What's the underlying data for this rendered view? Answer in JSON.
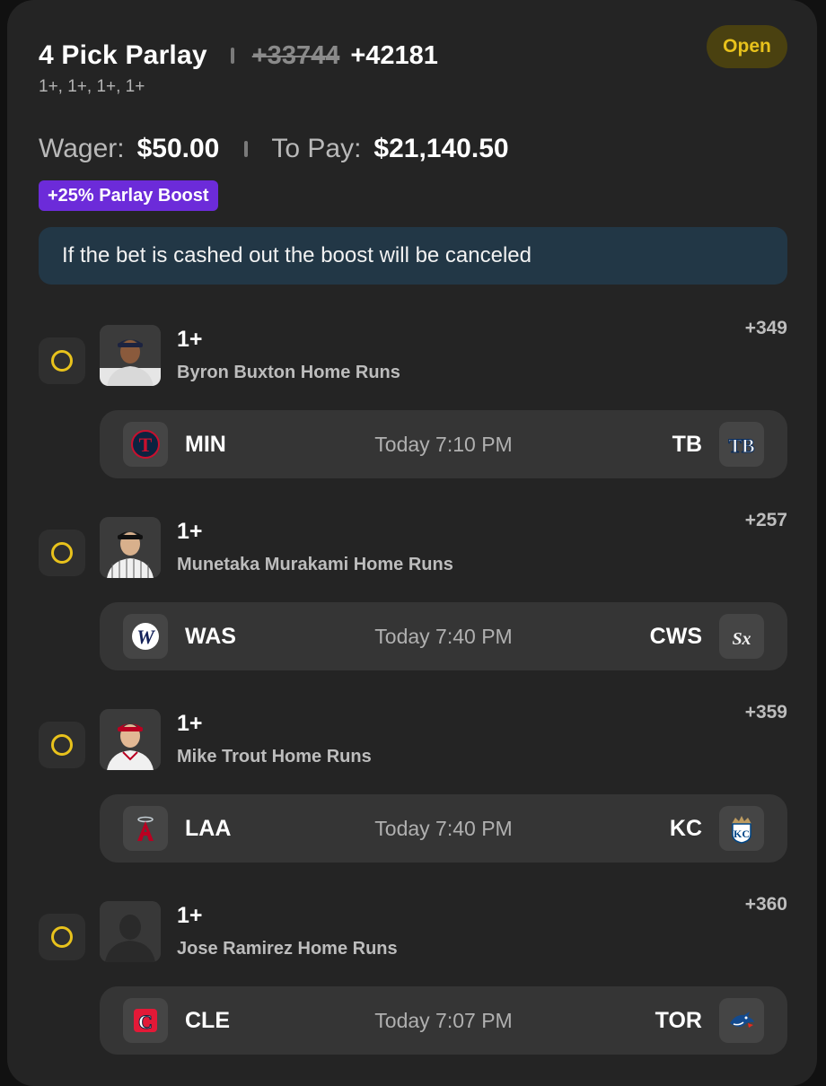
{
  "header": {
    "title": "4 Pick Parlay",
    "original_odds": "+33744",
    "boosted_odds": "+42181",
    "subtitle": "1+, 1+, 1+, 1+",
    "status": "Open"
  },
  "wager": {
    "wager_label": "Wager:",
    "wager_value": "$50.00",
    "pay_label": "To Pay:",
    "pay_value": "$21,140.50"
  },
  "boost_badge": "+25% Parlay Boost",
  "notice": "If the bet is cashed out the boost will be canceled",
  "legs": [
    {
      "line": "1+",
      "player": "Byron Buxton Home Runs",
      "odds": "+349",
      "away": "MIN",
      "time": "Today 7:10 PM",
      "home": "TB",
      "away_icon": "twins-logo-icon",
      "home_icon": "rays-logo-icon"
    },
    {
      "line": "1+",
      "player": "Munetaka Murakami Home Runs",
      "odds": "+257",
      "away": "WAS",
      "time": "Today 7:40 PM",
      "home": "CWS",
      "away_icon": "nationals-logo-icon",
      "home_icon": "white-sox-logo-icon"
    },
    {
      "line": "1+",
      "player": "Mike Trout Home Runs",
      "odds": "+359",
      "away": "LAA",
      "time": "Today 7:40 PM",
      "home": "KC",
      "away_icon": "angels-logo-icon",
      "home_icon": "royals-logo-icon"
    },
    {
      "line": "1+",
      "player": "Jose Ramirez Home Runs",
      "odds": "+360",
      "away": "CLE",
      "time": "Today 7:07 PM",
      "home": "TOR",
      "away_icon": "guardians-logo-icon",
      "home_icon": "blue-jays-logo-icon"
    }
  ],
  "colors": {
    "accent_yellow": "#e8c21c",
    "boost_purple": "#6c2bd9",
    "notice_bg": "#223746",
    "card_bg": "#242424"
  }
}
